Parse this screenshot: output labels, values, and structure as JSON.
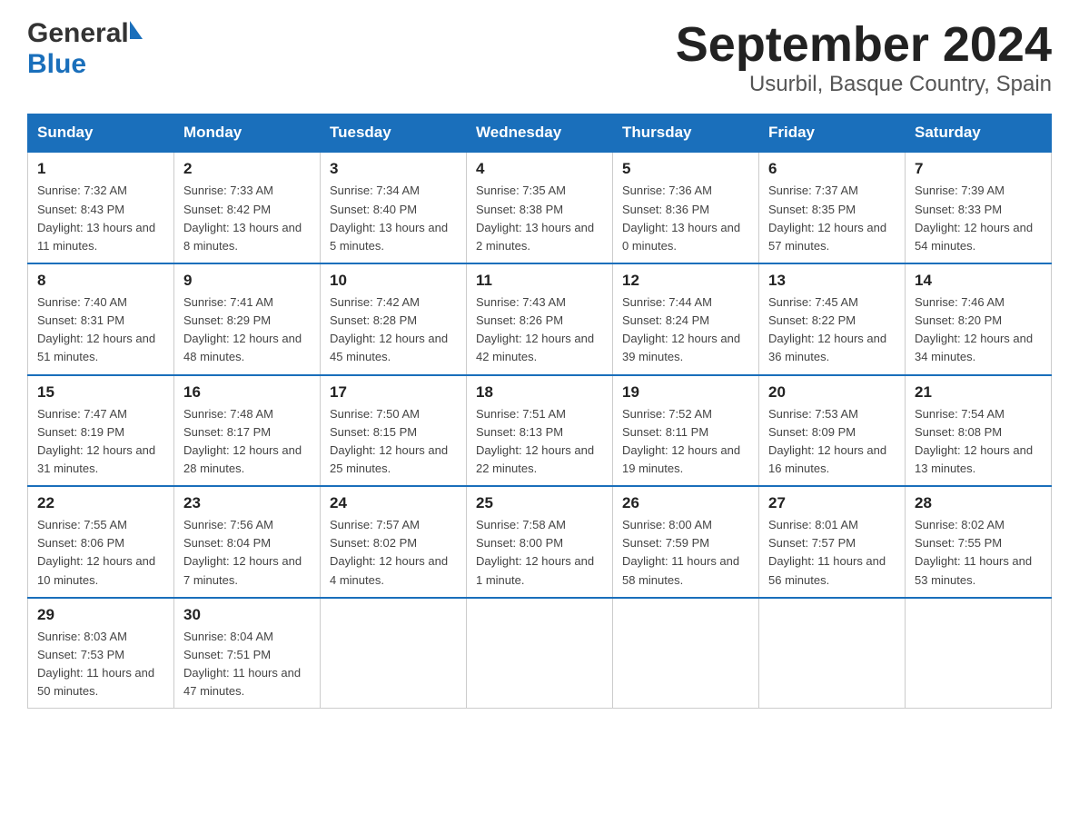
{
  "header": {
    "logo_general": "General",
    "logo_blue": "Blue",
    "title": "September 2024",
    "subtitle": "Usurbil, Basque Country, Spain"
  },
  "calendar": {
    "days_of_week": [
      "Sunday",
      "Monday",
      "Tuesday",
      "Wednesday",
      "Thursday",
      "Friday",
      "Saturday"
    ],
    "weeks": [
      [
        {
          "day": "1",
          "sunrise": "7:32 AM",
          "sunset": "8:43 PM",
          "daylight": "13 hours and 11 minutes."
        },
        {
          "day": "2",
          "sunrise": "7:33 AM",
          "sunset": "8:42 PM",
          "daylight": "13 hours and 8 minutes."
        },
        {
          "day": "3",
          "sunrise": "7:34 AM",
          "sunset": "8:40 PM",
          "daylight": "13 hours and 5 minutes."
        },
        {
          "day": "4",
          "sunrise": "7:35 AM",
          "sunset": "8:38 PM",
          "daylight": "13 hours and 2 minutes."
        },
        {
          "day": "5",
          "sunrise": "7:36 AM",
          "sunset": "8:36 PM",
          "daylight": "13 hours and 0 minutes."
        },
        {
          "day": "6",
          "sunrise": "7:37 AM",
          "sunset": "8:35 PM",
          "daylight": "12 hours and 57 minutes."
        },
        {
          "day": "7",
          "sunrise": "7:39 AM",
          "sunset": "8:33 PM",
          "daylight": "12 hours and 54 minutes."
        }
      ],
      [
        {
          "day": "8",
          "sunrise": "7:40 AM",
          "sunset": "8:31 PM",
          "daylight": "12 hours and 51 minutes."
        },
        {
          "day": "9",
          "sunrise": "7:41 AM",
          "sunset": "8:29 PM",
          "daylight": "12 hours and 48 minutes."
        },
        {
          "day": "10",
          "sunrise": "7:42 AM",
          "sunset": "8:28 PM",
          "daylight": "12 hours and 45 minutes."
        },
        {
          "day": "11",
          "sunrise": "7:43 AM",
          "sunset": "8:26 PM",
          "daylight": "12 hours and 42 minutes."
        },
        {
          "day": "12",
          "sunrise": "7:44 AM",
          "sunset": "8:24 PM",
          "daylight": "12 hours and 39 minutes."
        },
        {
          "day": "13",
          "sunrise": "7:45 AM",
          "sunset": "8:22 PM",
          "daylight": "12 hours and 36 minutes."
        },
        {
          "day": "14",
          "sunrise": "7:46 AM",
          "sunset": "8:20 PM",
          "daylight": "12 hours and 34 minutes."
        }
      ],
      [
        {
          "day": "15",
          "sunrise": "7:47 AM",
          "sunset": "8:19 PM",
          "daylight": "12 hours and 31 minutes."
        },
        {
          "day": "16",
          "sunrise": "7:48 AM",
          "sunset": "8:17 PM",
          "daylight": "12 hours and 28 minutes."
        },
        {
          "day": "17",
          "sunrise": "7:50 AM",
          "sunset": "8:15 PM",
          "daylight": "12 hours and 25 minutes."
        },
        {
          "day": "18",
          "sunrise": "7:51 AM",
          "sunset": "8:13 PM",
          "daylight": "12 hours and 22 minutes."
        },
        {
          "day": "19",
          "sunrise": "7:52 AM",
          "sunset": "8:11 PM",
          "daylight": "12 hours and 19 minutes."
        },
        {
          "day": "20",
          "sunrise": "7:53 AM",
          "sunset": "8:09 PM",
          "daylight": "12 hours and 16 minutes."
        },
        {
          "day": "21",
          "sunrise": "7:54 AM",
          "sunset": "8:08 PM",
          "daylight": "12 hours and 13 minutes."
        }
      ],
      [
        {
          "day": "22",
          "sunrise": "7:55 AM",
          "sunset": "8:06 PM",
          "daylight": "12 hours and 10 minutes."
        },
        {
          "day": "23",
          "sunrise": "7:56 AM",
          "sunset": "8:04 PM",
          "daylight": "12 hours and 7 minutes."
        },
        {
          "day": "24",
          "sunrise": "7:57 AM",
          "sunset": "8:02 PM",
          "daylight": "12 hours and 4 minutes."
        },
        {
          "day": "25",
          "sunrise": "7:58 AM",
          "sunset": "8:00 PM",
          "daylight": "12 hours and 1 minute."
        },
        {
          "day": "26",
          "sunrise": "8:00 AM",
          "sunset": "7:59 PM",
          "daylight": "11 hours and 58 minutes."
        },
        {
          "day": "27",
          "sunrise": "8:01 AM",
          "sunset": "7:57 PM",
          "daylight": "11 hours and 56 minutes."
        },
        {
          "day": "28",
          "sunrise": "8:02 AM",
          "sunset": "7:55 PM",
          "daylight": "11 hours and 53 minutes."
        }
      ],
      [
        {
          "day": "29",
          "sunrise": "8:03 AM",
          "sunset": "7:53 PM",
          "daylight": "11 hours and 50 minutes."
        },
        {
          "day": "30",
          "sunrise": "8:04 AM",
          "sunset": "7:51 PM",
          "daylight": "11 hours and 47 minutes."
        },
        {
          "day": "",
          "sunrise": "",
          "sunset": "",
          "daylight": ""
        },
        {
          "day": "",
          "sunrise": "",
          "sunset": "",
          "daylight": ""
        },
        {
          "day": "",
          "sunrise": "",
          "sunset": "",
          "daylight": ""
        },
        {
          "day": "",
          "sunrise": "",
          "sunset": "",
          "daylight": ""
        },
        {
          "day": "",
          "sunrise": "",
          "sunset": "",
          "daylight": ""
        }
      ]
    ]
  }
}
